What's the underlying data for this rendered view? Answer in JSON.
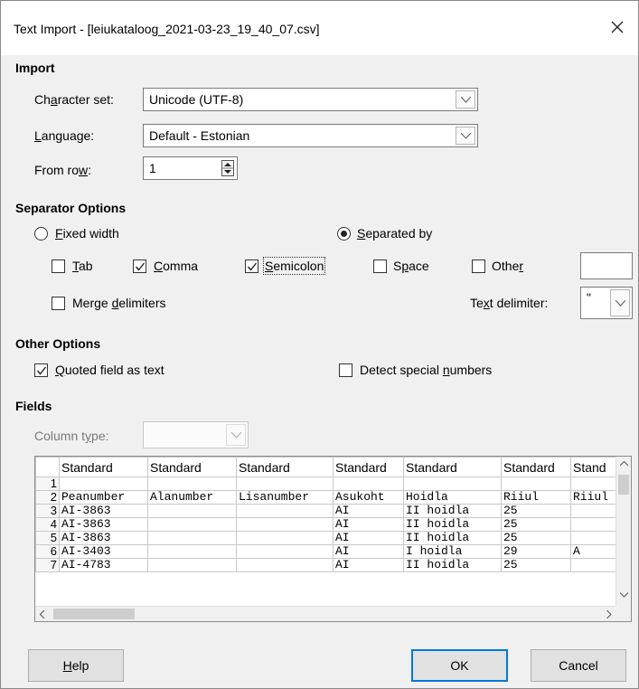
{
  "window": {
    "title": "Text Import - [leiukataloog_2021-03-23_19_40_07.csv]"
  },
  "import": {
    "section": "Import",
    "charset_label_pre": "Ch",
    "charset_label_u": "a",
    "charset_label_post": "racter set:",
    "charset_value": "Unicode (UTF-8)",
    "language_label_u": "L",
    "language_label_post": "anguage:",
    "language_value": "Default - Estonian",
    "fromrow_label_pre": "From ro",
    "fromrow_label_u": "w",
    "fromrow_label_post": ":",
    "fromrow_value": "1"
  },
  "separator": {
    "section": "Separator Options",
    "fixed_u": "F",
    "fixed_post": "ixed width",
    "sepby_u": "S",
    "sepby_post": "eparated by",
    "tab_u": "T",
    "tab_post": "ab",
    "comma_u": "C",
    "comma_post": "omma",
    "semicolon_u": "S",
    "semicolon_post": "emicolon",
    "space_pre": "S",
    "space_u": "p",
    "space_post": "ace",
    "other_pre": "Othe",
    "other_u": "r",
    "merge_pre": "Merge ",
    "merge_u": "d",
    "merge_post": "elimiters",
    "textdelim_pre": "Te",
    "textdelim_u": "x",
    "textdelim_post": "t delimiter:",
    "textdelim_value": "\""
  },
  "other_options": {
    "section": "Other Options",
    "quoted_u": "Q",
    "quoted_post": "uoted field as text",
    "detect_pre": "Detect special ",
    "detect_u": "n",
    "detect_post": "umbers"
  },
  "fields": {
    "section": "Fields",
    "coltype_pre": "Column t",
    "coltype_u": "y",
    "coltype_post": "pe:",
    "headers": [
      "Standard",
      "Standard",
      "Standard",
      "Standard",
      "Standard",
      "Standard",
      "Stand"
    ],
    "rows": [
      [
        "1",
        "",
        "",
        "",
        "",
        "",
        "",
        ""
      ],
      [
        "2",
        "Peanumber",
        "Alanumber",
        "Lisanumber",
        "Asukoht",
        "Hoidla",
        "Riiul",
        "Riiul"
      ],
      [
        "3",
        "AI-3863",
        "",
        "",
        "AI",
        "II hoidla",
        "25",
        ""
      ],
      [
        "4",
        "AI-3863",
        "",
        "",
        "AI",
        "II hoidla",
        "25",
        ""
      ],
      [
        "5",
        "AI-3863",
        "",
        "",
        "AI",
        "II hoidla",
        "25",
        ""
      ],
      [
        "6",
        "AI-3403",
        "",
        "",
        "AI",
        "I hoidla",
        "29",
        "A"
      ],
      [
        "7",
        "AI-4783",
        "",
        "",
        "AI",
        "II hoidla",
        "25",
        ""
      ]
    ]
  },
  "buttons": {
    "help_u": "H",
    "help_post": "elp",
    "ok": "OK",
    "cancel": "Cancel"
  }
}
